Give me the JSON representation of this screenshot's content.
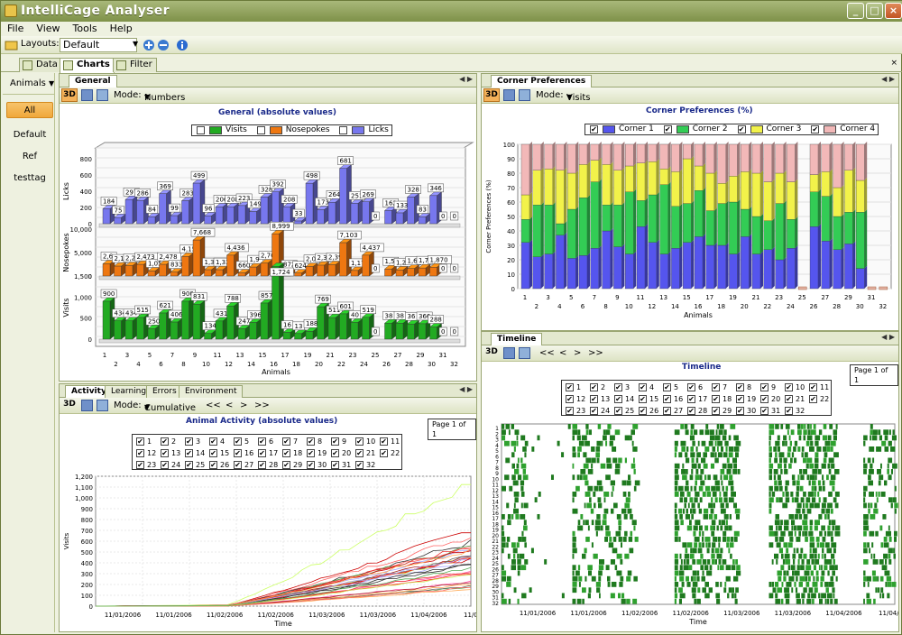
{
  "window": {
    "title": "IntelliCage Analyser",
    "min": "_",
    "max": "□",
    "close": "×"
  },
  "menu": [
    "File",
    "View",
    "Tools",
    "Help"
  ],
  "toolbar": {
    "layouts_label": "Layouts:",
    "layout_value": "Default"
  },
  "doc_tabs": [
    {
      "label": "Data"
    },
    {
      "label": "Charts"
    },
    {
      "label": "Filter"
    }
  ],
  "sidebar": {
    "header": "Animals",
    "items": [
      "All",
      "Default",
      "Ref",
      "testtag"
    ]
  },
  "colors": {
    "visits": "#22aa22",
    "nosepokes": "#ee7711",
    "licks": "#7777ee",
    "corner1": "#5555ee",
    "corner2": "#33cc55",
    "corner3": "#f2f24a",
    "corner4": "#f2b8b8",
    "timeline": "#1f7a1f"
  },
  "general": {
    "tab": "General",
    "mode_label": "Mode:",
    "mode_value": "Numbers",
    "btn3d": "3D",
    "chart_data": {
      "type": "bar",
      "title": "General (absolute values)",
      "xlabel": "Animals",
      "legend": [
        "Visits",
        "Nosepokes",
        "Licks"
      ],
      "categories": [
        1,
        2,
        3,
        4,
        5,
        6,
        7,
        8,
        9,
        10,
        11,
        12,
        13,
        14,
        15,
        16,
        17,
        18,
        19,
        20,
        21,
        22,
        23,
        24,
        25,
        26,
        27,
        28,
        29,
        30,
        31,
        32
      ],
      "x_tick_top": [
        "1",
        "3",
        "5",
        "7",
        "9",
        "11",
        "13",
        "15",
        "17",
        "19",
        "21",
        "23",
        "25",
        "27",
        "29",
        "31"
      ],
      "x_tick_bottom": [
        "2",
        "4",
        "6",
        "8",
        "10",
        "12",
        "14",
        "16",
        "18",
        "20",
        "22",
        "24",
        "26",
        "28",
        "30",
        "32"
      ],
      "licks": {
        "ylabel": "Licks",
        "yticks": [
          "0",
          "200",
          "400",
          "600",
          "800"
        ],
        "ylim": [
          0,
          800
        ],
        "values": [
          184,
          75,
          297,
          286,
          84,
          369,
          99,
          283,
          499,
          96,
          206,
          208,
          223,
          149,
          328,
          392,
          208,
          33,
          498,
          173,
          264,
          681,
          251,
          269,
          0,
          162,
          133,
          328,
          83,
          346,
          0,
          0
        ]
      },
      "nosepokes": {
        "ylabel": "Nosepokes",
        "yticks": [
          "0",
          "5,000",
          "10,000"
        ],
        "ylim": [
          0,
          10000
        ],
        "values": [
          2600,
          2100,
          2200,
          2473,
          1054,
          2478,
          833,
          4152,
          7668,
          1330,
          1330,
          4436,
          660,
          1900,
          2766,
          8999,
          872,
          624,
          2000,
          2300,
          2399,
          7103,
          1172,
          4437,
          0,
          1500,
          1278,
          1600,
          1700,
          1870,
          0,
          0
        ],
        "labels": [
          "2,6",
          "2,1",
          "2,2",
          "2,473",
          "1,054",
          "2,478",
          "833",
          "4,152",
          "7,668",
          "1,330",
          "1,33",
          "4,436",
          "660",
          "1,9",
          "2,766",
          "8,999",
          "872",
          "624",
          "2,0",
          "2,3",
          "2,399",
          "7,103",
          "1,172",
          "4,437",
          "0",
          "1,5",
          "1,278",
          "1,6",
          "1,7",
          "1,870",
          "0",
          "0"
        ]
      },
      "visits": {
        "ylabel": "Visits",
        "yticks": [
          "0",
          "500",
          "1,000",
          "1,500"
        ],
        "ylim": [
          0,
          1500
        ],
        "values": [
          900,
          434,
          434,
          515,
          250,
          621,
          406,
          900,
          831,
          134,
          431,
          788,
          247,
          396,
          857,
          1724,
          160,
          132,
          188,
          769,
          511,
          601,
          401,
          519,
          0,
          380,
          380,
          360,
          366,
          288,
          0,
          0
        ],
        "labels": [
          "900",
          "434",
          "434",
          "515",
          "250",
          "621",
          "406",
          "900",
          "831",
          "134",
          "431",
          "788",
          "247",
          "396",
          "857",
          "1,724",
          "16",
          "13",
          "188",
          "769",
          "511",
          "601",
          "40",
          "519",
          "0",
          "38",
          "38",
          "36",
          "366",
          "288",
          "0",
          "0"
        ]
      }
    }
  },
  "corner": {
    "tab": "Corner Preferences",
    "mode_label": "Mode:",
    "mode_value": "Visits",
    "btn3d": "3D",
    "chart_data": {
      "type": "bar",
      "title": "Corner Preferences (%)",
      "ylabel": "Corner Preferences (%)",
      "xlabel": "Animals",
      "legend": [
        "Corner 1",
        "Corner 2",
        "Corner 3",
        "Corner 4"
      ],
      "yticks": [
        "0",
        "10",
        "20",
        "30",
        "40",
        "50",
        "60",
        "70",
        "80",
        "90",
        "100"
      ],
      "ylim": [
        0,
        100
      ],
      "x_tick_top": [
        "1",
        "3",
        "5",
        "7",
        "9",
        "11",
        "13",
        "15",
        "17",
        "19",
        "21",
        "23",
        "25",
        "27",
        "29",
        "31"
      ],
      "x_tick_bottom": [
        "2",
        "4",
        "6",
        "8",
        "10",
        "12",
        "14",
        "16",
        "18",
        "20",
        "22",
        "24",
        "26",
        "28",
        "30",
        "32"
      ],
      "c1": [
        32,
        22,
        24,
        37,
        21,
        23,
        28,
        40,
        29,
        24,
        43,
        32,
        24,
        28,
        32,
        36,
        30,
        30,
        24,
        36,
        24,
        27,
        20,
        28,
        0,
        43,
        33,
        27,
        31,
        14,
        0,
        0
      ],
      "c2": [
        16,
        36,
        34,
        8,
        34,
        40,
        46,
        18,
        29,
        43,
        18,
        33,
        48,
        29,
        27,
        32,
        24,
        29,
        36,
        19,
        26,
        20,
        39,
        20,
        0,
        24,
        31,
        23,
        22,
        39,
        0,
        0
      ],
      "c3": [
        17,
        24,
        25,
        37,
        25,
        23,
        15,
        28,
        24,
        18,
        26,
        23,
        11,
        24,
        31,
        17,
        26,
        14,
        18,
        26,
        30,
        27,
        21,
        26,
        0,
        12,
        17,
        20,
        29,
        22,
        0,
        0
      ]
    }
  },
  "activity": {
    "tabs": [
      "Activity",
      "Learning",
      "Errors",
      "Environment"
    ],
    "mode_label": "Mode:",
    "mode_value": "Cumulative",
    "btn3d": "3D",
    "nav": [
      "<<",
      "<",
      ">",
      ">>"
    ],
    "page": "Page 1 of 1",
    "checklist": [
      "1",
      "2",
      "3",
      "4",
      "5",
      "6",
      "7",
      "8",
      "9",
      "10",
      "11",
      "12",
      "13",
      "14",
      "15",
      "16",
      "17",
      "18",
      "19",
      "20",
      "21",
      "22",
      "23",
      "24",
      "25",
      "26",
      "27",
      "28",
      "29",
      "30",
      "31",
      "32"
    ],
    "chart_data": {
      "type": "line",
      "title": "Animal Activity (absolute values)",
      "ylabel": "Visits",
      "xlabel": "Time",
      "yticks": [
        "0",
        "100",
        "200",
        "300",
        "400",
        "500",
        "600",
        "700",
        "800",
        "900",
        "1,000",
        "1,100",
        "1,200"
      ],
      "ylim": [
        0,
        1200
      ],
      "xticks": [
        "11/01/2006",
        "11/01/2006",
        "11/02/2006",
        "11/02/2006",
        "11/03/2006",
        "11/03/2006",
        "11/04/2006",
        "11/04/200"
      ]
    }
  },
  "timeline": {
    "tab": "Timeline",
    "btn3d": "3D",
    "nav": [
      "<<",
      "<",
      ">",
      ">>"
    ],
    "page": "Page 1 of 1",
    "checklist": [
      "1",
      "2",
      "3",
      "4",
      "5",
      "6",
      "7",
      "8",
      "9",
      "10",
      "11",
      "12",
      "13",
      "14",
      "15",
      "16",
      "17",
      "18",
      "19",
      "20",
      "21",
      "22",
      "23",
      "24",
      "25",
      "26",
      "27",
      "28",
      "29",
      "30",
      "31",
      "32"
    ],
    "chart_data": {
      "type": "heatmap",
      "title": "Timeline",
      "xlabel": "Time",
      "yticks": [
        "1",
        "2",
        "3",
        "4",
        "5",
        "6",
        "7",
        "8",
        "9",
        "10",
        "11",
        "12",
        "13",
        "14",
        "15",
        "16",
        "17",
        "18",
        "19",
        "20",
        "21",
        "22",
        "23",
        "24",
        "25",
        "26",
        "27",
        "28",
        "29",
        "30",
        "31",
        "32"
      ],
      "xticks": [
        "11/01/2006",
        "11/01/2006",
        "11/02/2006",
        "11/02/2006",
        "11/03/2006",
        "11/03/2006",
        "11/04/2006",
        "11/04/200"
      ]
    }
  }
}
